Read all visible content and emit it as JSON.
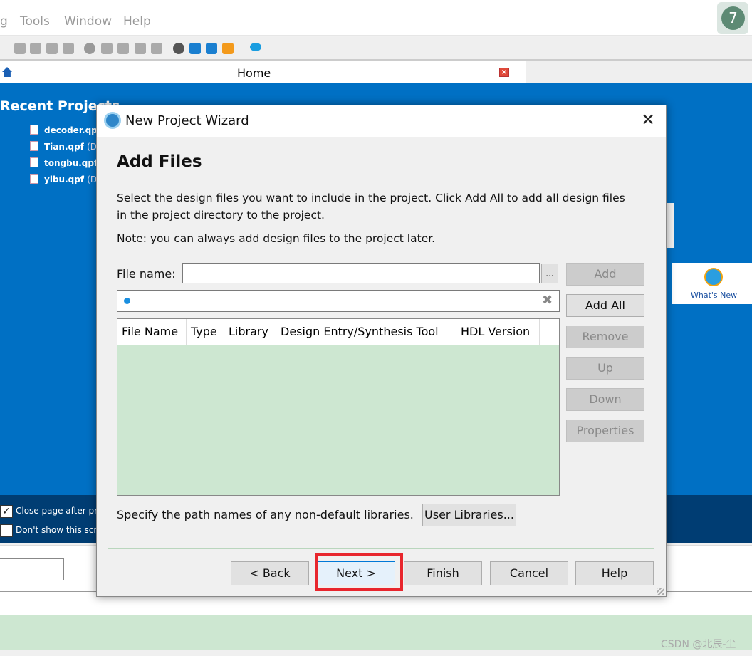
{
  "menu": {
    "items": [
      "g",
      "Tools",
      "Window",
      "Help"
    ]
  },
  "badge": "7",
  "tab": {
    "title": "Home"
  },
  "start_page": {
    "recent_title": "Recent Projects",
    "projects": [
      {
        "name": "decoder.qpf",
        "path": ""
      },
      {
        "name": "Tian.qpf",
        "path": "(D:"
      },
      {
        "name": "tongbu.qpf",
        "path": ""
      },
      {
        "name": "yibu.qpf",
        "path": "(D:"
      }
    ],
    "whats_new": "What's New",
    "close_page_label": "Close page after pr",
    "close_page_checked": true,
    "dont_show_label": "Don't show this scr",
    "dont_show_checked": false
  },
  "dialog": {
    "title": "New Project Wizard",
    "heading": "Add Files",
    "desc1": "Select the design files you want to include in the project. Click Add All to add all design files",
    "desc2": "in the project directory to the project.",
    "note": "Note: you can always add design files to the project later.",
    "file_name_label": "File name:",
    "file_name_value": "",
    "browse": "...",
    "search_value": "",
    "columns": [
      "File Name",
      "Type",
      "Library",
      "Design Entry/Synthesis Tool",
      "HDL Version"
    ],
    "side_buttons": [
      {
        "label": "Add",
        "enabled": false
      },
      {
        "label": "Add All",
        "enabled": true
      },
      {
        "label": "Remove",
        "enabled": false
      },
      {
        "label": "Up",
        "enabled": false
      },
      {
        "label": "Down",
        "enabled": false
      },
      {
        "label": "Properties",
        "enabled": false
      }
    ],
    "libraries_label": "Specify the path names of any non-default libraries.",
    "user_libraries": "User Libraries...",
    "buttons": {
      "back": "< Back",
      "next": "Next >",
      "finish": "Finish",
      "cancel": "Cancel",
      "help": "Help"
    }
  },
  "watermark": "CSDN @北辰-尘",
  "colors": {
    "start_blue": "#0070c4",
    "dark_blue": "#003d73",
    "table_bg": "#cde7d1",
    "highlight": "#e8262d"
  }
}
